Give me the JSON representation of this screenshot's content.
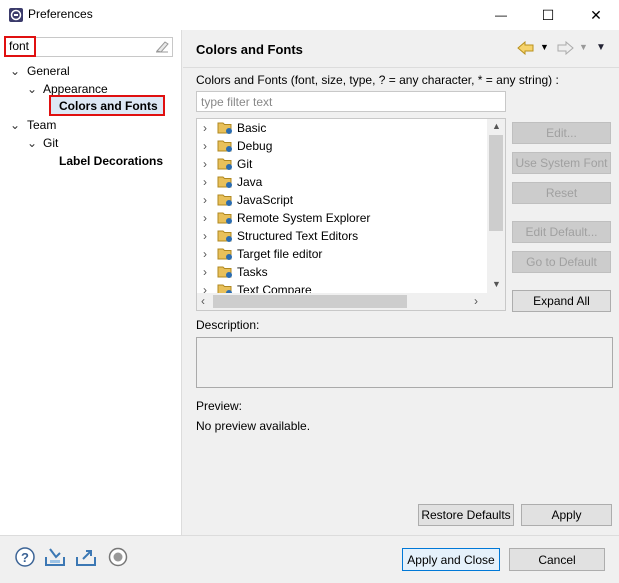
{
  "window": {
    "title": "Preferences",
    "minimize_glyph": "—",
    "maximize_glyph": "☐",
    "close_glyph": "✕"
  },
  "sidebar": {
    "filter_value": "font",
    "tree": [
      {
        "label": "General",
        "expanded": true
      },
      {
        "label": "Appearance",
        "expanded": true
      },
      {
        "label": "Colors and Fonts",
        "selected": true
      },
      {
        "label": "Team",
        "expanded": true
      },
      {
        "label": "Git",
        "expanded": true
      },
      {
        "label": "Label Decorations"
      }
    ]
  },
  "main": {
    "title": "Colors and Fonts",
    "description": "Colors and Fonts (font, size, type, ? = any character, * = any string) :",
    "filter_placeholder": "type filter text",
    "categories": [
      "Basic",
      "Debug",
      "Git",
      "Java",
      "JavaScript",
      "Remote System Explorer",
      "Structured Text Editors",
      "Target file editor",
      "Tasks",
      "Text Compare"
    ],
    "buttons": {
      "edit": "Edit...",
      "use_system_font": "Use System Font",
      "reset": "Reset",
      "edit_default": "Edit Default...",
      "go_to_default": "Go to Default",
      "expand_all": "Expand All"
    },
    "description_label": "Description:",
    "preview_label": "Preview:",
    "preview_text": "No preview available.",
    "restore_defaults": "Restore Defaults",
    "apply": "Apply"
  },
  "footer": {
    "apply_and_close": "Apply and Close",
    "cancel": "Cancel",
    "icons": [
      "help-icon",
      "import-icon",
      "export-icon",
      "record-icon"
    ]
  }
}
